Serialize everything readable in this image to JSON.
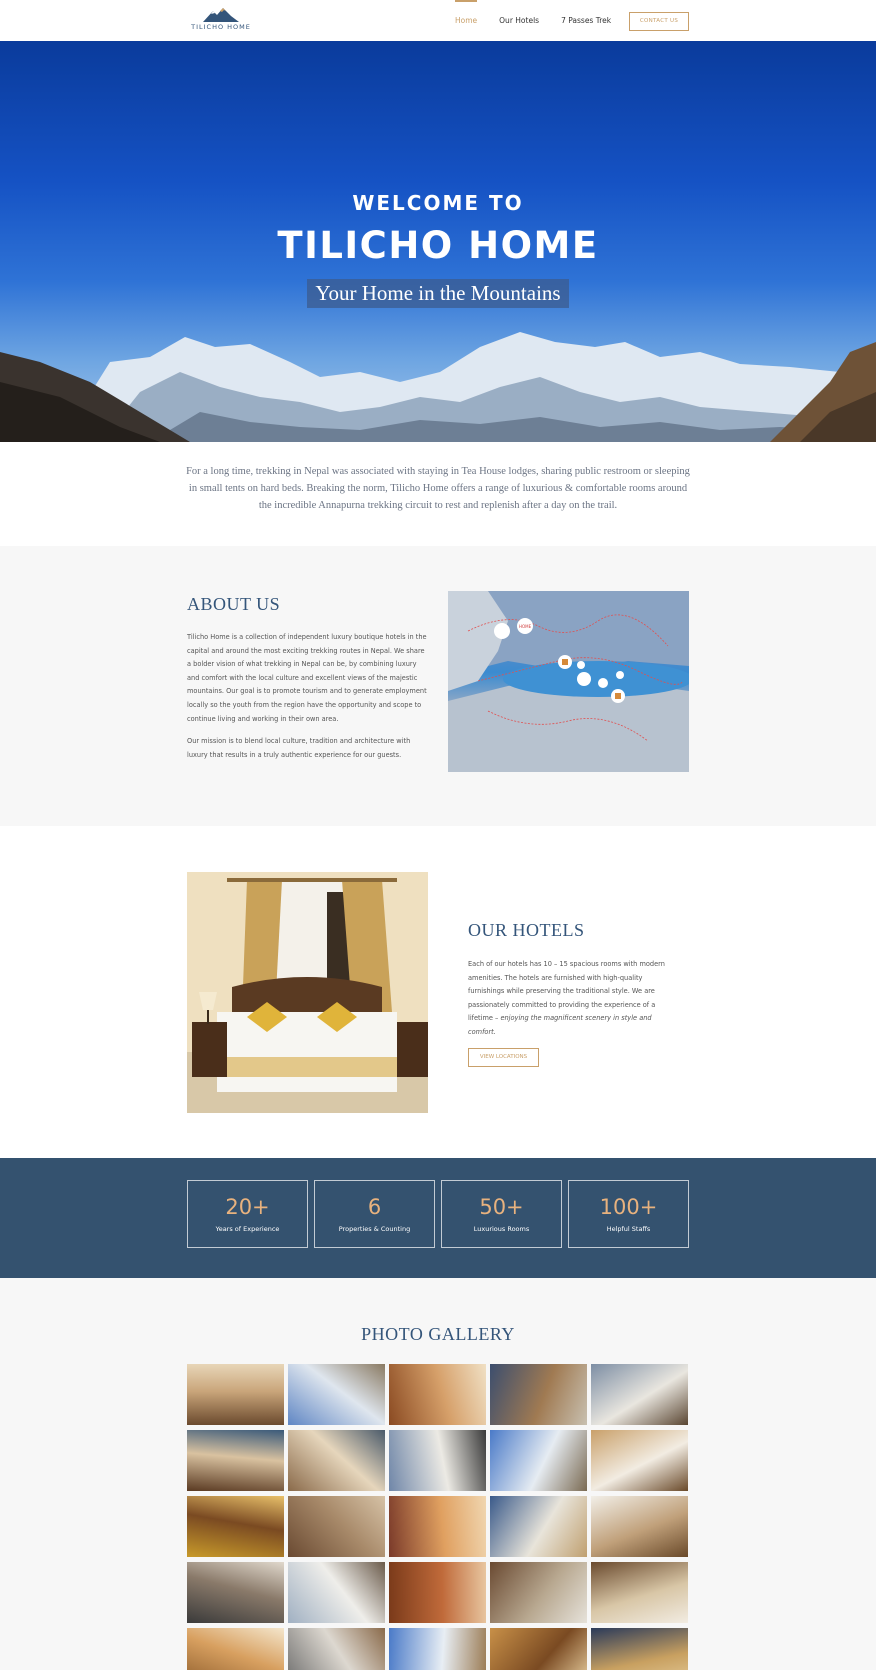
{
  "nav": {
    "logo_text": "TILICHO HOME",
    "links": [
      "Home",
      "Our Hotels",
      "7 Passes Trek"
    ],
    "contact_label": "CONTACT US"
  },
  "hero": {
    "welcome": "WELCOME TO",
    "title": "TILICHO HOME",
    "subtitle": "Your Home in the Mountains"
  },
  "intro": "For a long time, trekking in Nepal was associated with staying in Tea House lodges, sharing public restroom or sleeping in small tents on hard beds. Breaking the norm, Tilicho Home offers a range of luxurious & comfortable rooms around the incredible Annapurna trekking circuit to rest and replenish after a day on the trail.",
  "about": {
    "heading": "ABOUT US",
    "para1": "Tilicho Home is a collection of independent luxury boutique hotels in the capital and around the most exciting trekking routes in Nepal. We share a bolder vision of what trekking in Nepal can be, by combining luxury and comfort with the local culture and excellent views of the majestic mountains. Our goal is to promote tourism and to generate employment locally so the youth from the region have the opportunity and scope to continue living and working in their own area.",
    "para2": "Our mission is to blend local culture, tradition and architecture with luxury that results in a truly authentic experience for our guests."
  },
  "hotels": {
    "heading": "OUR HOTELS",
    "para_plain": "Each of our hotels has 10 – 15 spacious rooms with modern amenities. The hotels are furnished with high-quality furnishings while preserving the traditional style. We are passionately committed to providing the experience of a lifetime – ",
    "para_em": "enjoying the magnificent scenery in style and comfort.",
    "button": "VIEW LOCATIONS"
  },
  "stats": [
    {
      "value": "20+",
      "label": "Years of Experience"
    },
    {
      "value": "6",
      "label": "Properties & Counting"
    },
    {
      "value": "50+",
      "label": "Luxurious Rooms"
    },
    {
      "value": "100+",
      "label": "Helpful Staffs"
    }
  ],
  "gallery": {
    "heading": "PHOTO GALLERY"
  },
  "colors": {
    "accent": "#c9a06a",
    "heading": "#34557a",
    "stats_bg": "#34526f",
    "stat_number": "#e8b27e"
  }
}
